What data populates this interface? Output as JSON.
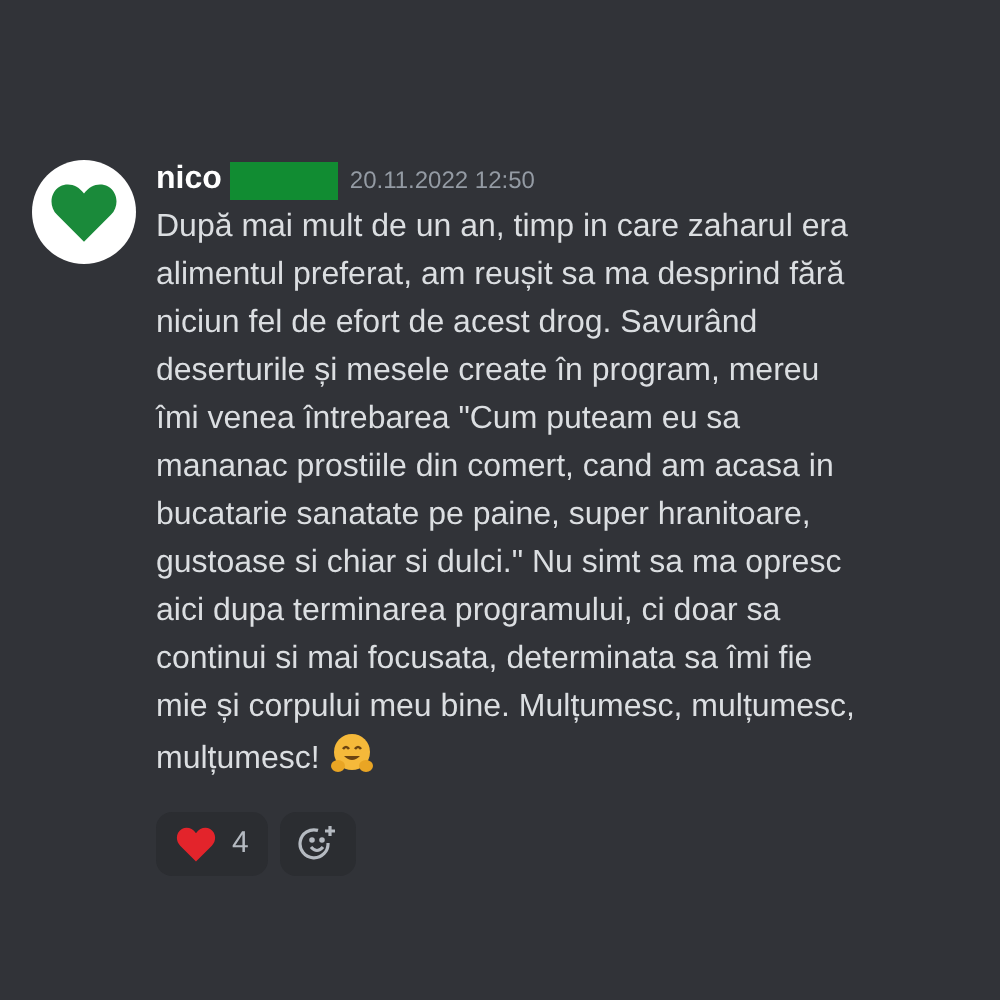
{
  "message": {
    "author": "nico",
    "redacted": true,
    "timestamp": "20.11.2022 12:50",
    "lines": [
      "După mai mult de un an, timp in care zaharul era",
      "alimentul preferat, am reușit sa ma desprind fără",
      "niciun fel de efort de acest drog. Savurând",
      "deserturile și mesele create în program, mereu",
      "îmi venea întrebarea \"Cum puteam eu sa",
      "mananac prostiile din comert, cand am acasa in",
      "bucatarie sanatate pe paine, super hranitoare,",
      "gustoase si chiar si dulci.\" Nu simt sa ma opresc",
      "aici dupa terminarea programului, ci doar sa",
      "continui si mai focusata, determinata sa îmi fie",
      "mie și corpului meu bine. Mulțumesc, mulțumesc,",
      "mulțumesc!"
    ],
    "reactions": [
      {
        "kind": "heart",
        "count": "4"
      }
    ]
  }
}
